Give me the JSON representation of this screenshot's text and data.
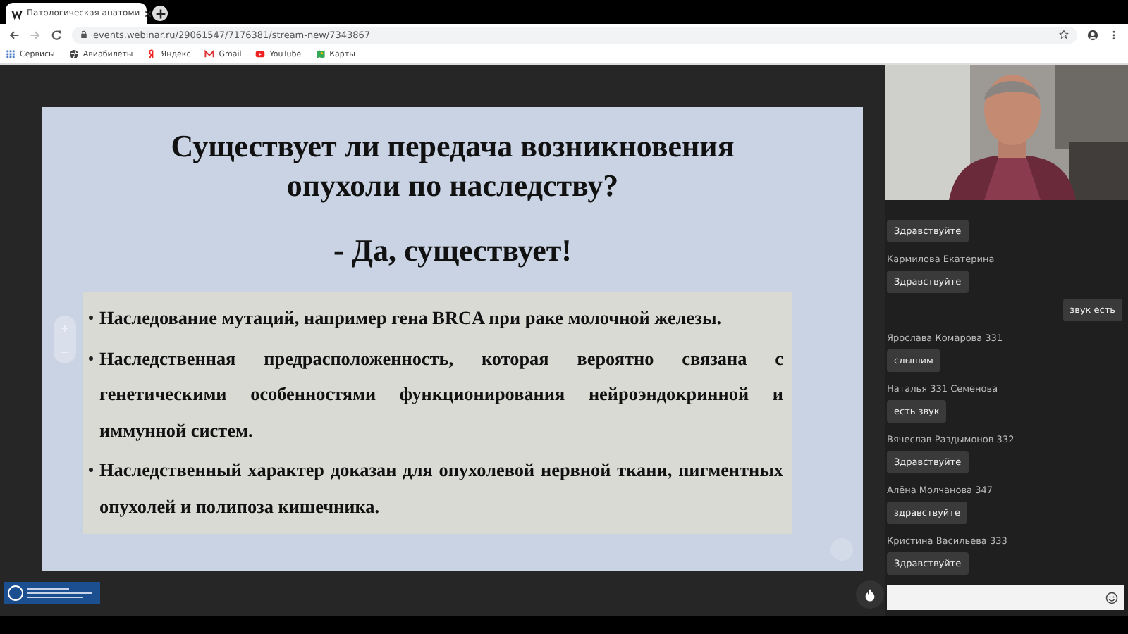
{
  "browser": {
    "tabs": [
      {
        "label": "Патологическая анатоми",
        "selected": true
      }
    ],
    "url": "events.webinar.ru/29061547/7176381/stream-new/7343867",
    "bookmarks": [
      {
        "label": "Сервисы",
        "kind": "apps"
      },
      {
        "label": "Авиабилеты",
        "kind": "globe"
      },
      {
        "label": "Яндекс",
        "kind": "yandex"
      },
      {
        "label": "Gmail",
        "kind": "gmail"
      },
      {
        "label": "YouTube",
        "kind": "youtube"
      },
      {
        "label": "Карты",
        "kind": "maps"
      }
    ]
  },
  "slide": {
    "title": "Существует ли передача возникновения опухоли по наследству?",
    "subtitle": "- Да, существует!",
    "bullets": [
      "Наследование мутаций, например гена BRCA при раке молочной железы.",
      "Наследственная предрасположенность, которая вероятно связана с генетическими особенностями функционирования нейроэндокринной и иммунной систем.",
      "Наследственный характер доказан для опухолевой нервной ткани, пигментных опухолей и полипоза кишечника."
    ]
  },
  "chat": {
    "messages": [
      {
        "kind": "incoming",
        "text": "Здравствуйте"
      },
      {
        "kind": "incoming",
        "author": "Кармилова Екатерина",
        "text": "Здравствуйте"
      },
      {
        "kind": "outgoing",
        "text": "звук есть"
      },
      {
        "kind": "incoming",
        "author": "Ярослава Комарова 331",
        "text": "слышим"
      },
      {
        "kind": "incoming",
        "author": "Наталья 331 Семенова",
        "text": "есть звук"
      },
      {
        "kind": "incoming",
        "author": "Вячеслав Раздымонов 332",
        "text": "Здравствуйте"
      },
      {
        "kind": "incoming",
        "author": "Алёна Молчанова 347",
        "text": "здравствуйте"
      },
      {
        "kind": "incoming",
        "author": "Кристина Васильева 333",
        "text": "Здравствуйте"
      }
    ]
  }
}
